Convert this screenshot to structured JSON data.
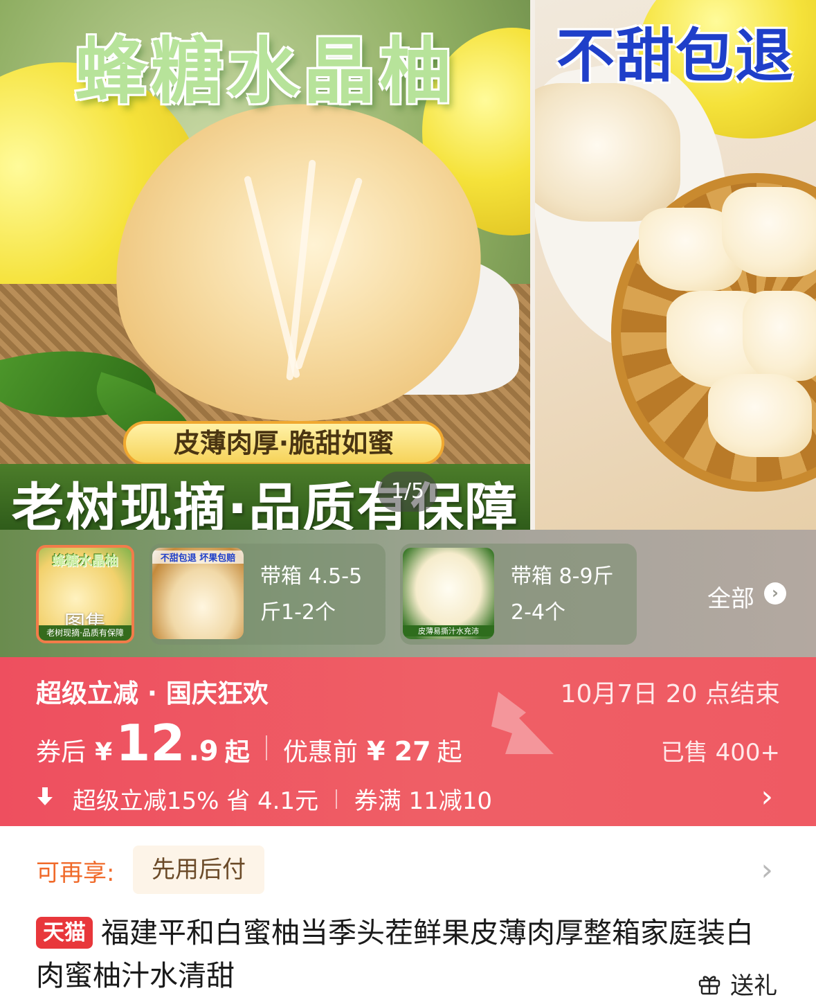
{
  "gallery": {
    "slide1_title": "蜂糖水晶柚",
    "slide1_pill": "皮薄肉厚·脆甜如蜜",
    "slide1_banner": "老树现摘·品质有保障",
    "counter": "1/5",
    "slide2_title": "不甜包退"
  },
  "variants": {
    "main_thumb": {
      "title": "蜂糖水晶柚",
      "label": "图集",
      "footer": "老树现摘·品质有保障"
    },
    "items": [
      {
        "tag": "不甜包退  坏果包赔",
        "label": "带箱 4.5-5斤1-2个"
      },
      {
        "tag": "皮薄易撕汁水充沛",
        "label": "带箱 8-9斤2-4个"
      }
    ],
    "all_label": "全部",
    "all_chevron": "›"
  },
  "promo": {
    "title": "超级立减 · 国庆狂欢",
    "end_time": "10月7日 20 点结束",
    "price_after_label": "券后",
    "currency": "¥",
    "price_int": "12",
    "price_dec": ".9",
    "price_suffix": "起",
    "price_before_label": "优惠前",
    "price_before": "¥ 27",
    "price_before_suffix": "起",
    "sold": "已售 400+",
    "discount_text": "超级立减15% 省 4.1元",
    "coupon_text": "券满 11减10",
    "chevron": "›"
  },
  "pay": {
    "label": "可再享:",
    "chip": "先用后付",
    "chevron": "›"
  },
  "product": {
    "badge": "天猫",
    "title": "福建平和白蜜柚当季头茬鲜果皮薄肉厚整箱家庭装白肉蜜柚汁水清甜",
    "gift_label": "送礼"
  },
  "colors": {
    "promo_red": "#ee4f5f",
    "tmall_red": "#e8373b",
    "pay_orange": "#f06a2a",
    "thumb_border": "#f27c4a"
  }
}
